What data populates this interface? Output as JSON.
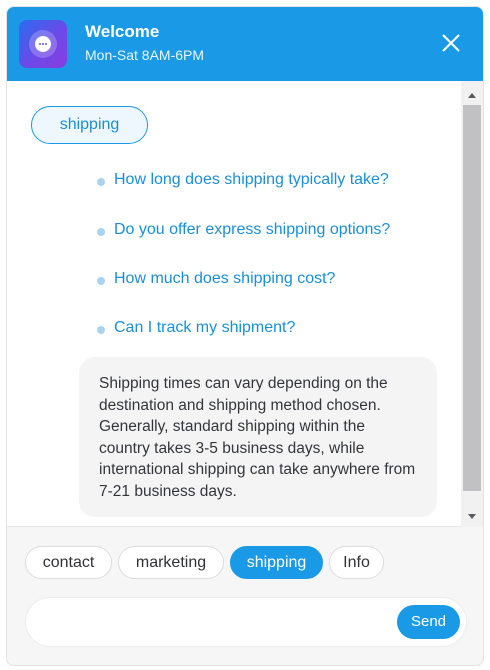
{
  "header": {
    "title": "Welcome",
    "subtitle": "Mon-Sat 8AM-6PM"
  },
  "chat": {
    "topic": "shipping",
    "questions": [
      "How long does shipping typically take?",
      "Do you offer express shipping options?",
      "How much does shipping cost?",
      "Can I track my shipment?"
    ],
    "answer": "Shipping times can vary depending on the destination and shipping method chosen. Generally, standard shipping within the country takes 3-5 business days, while international shipping can take anywhere from 7-21 business days."
  },
  "chips": [
    {
      "label": "contact",
      "active": false
    },
    {
      "label": "marketing",
      "active": false
    },
    {
      "label": "shipping",
      "active": true
    },
    {
      "label": "Info",
      "active": false
    }
  ],
  "composer": {
    "placeholder": "",
    "send_label": "Send"
  },
  "colors": {
    "accent": "#1a9ae6",
    "link": "#1a8fd9"
  }
}
